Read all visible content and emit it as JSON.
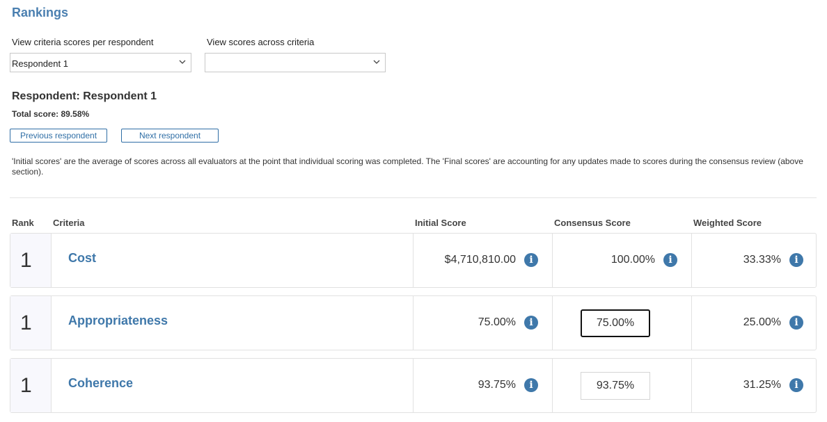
{
  "page": {
    "title": "Rankings"
  },
  "filters": {
    "per_respondent_label": "View criteria scores per respondent",
    "per_respondent_value": "Respondent 1",
    "across_criteria_label": "View scores across criteria",
    "across_criteria_value": ""
  },
  "respondent": {
    "heading": "Respondent: Respondent 1",
    "total_score": "Total score: 89.58%",
    "prev_label": "Previous respondent",
    "next_label": "Next respondent"
  },
  "note": "'Initial scores' are the average of scores across all evaluators at the point that individual scoring was completed. The 'Final scores' are accounting for any updates made to scores during the consensus review (above section).",
  "table": {
    "headers": {
      "rank": "Rank",
      "criteria": "Criteria",
      "initial": "Initial Score",
      "consensus": "Consensus Score",
      "weighted": "Weighted Score"
    },
    "rows": [
      {
        "rank": "1",
        "criteria": "Cost",
        "initial": "$4,710,810.00",
        "consensus": "100.00%",
        "weighted": "33.33%"
      },
      {
        "rank": "1",
        "criteria": "Appropriateness",
        "initial": "75.00%",
        "consensus": "75.00%",
        "weighted": "25.00%"
      },
      {
        "rank": "1",
        "criteria": "Coherence",
        "initial": "93.75%",
        "consensus": "93.75%",
        "weighted": "31.25%"
      }
    ]
  },
  "icons": {
    "info": "info-icon",
    "dropdown": "chevron-down-icon"
  },
  "colors": {
    "accent": "#3f78aa",
    "title": "#4a7fb0",
    "button": "#2f6ea5"
  }
}
